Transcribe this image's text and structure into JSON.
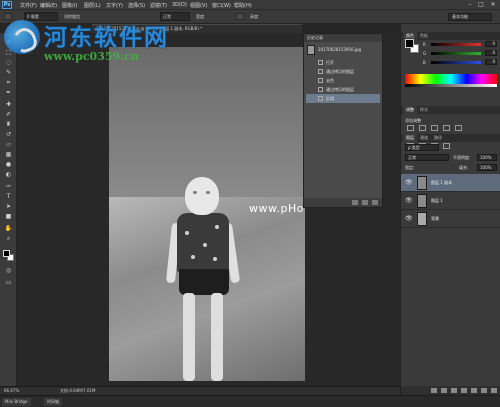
{
  "menubar": {
    "logo": "Ps",
    "items": [
      "文件(F)",
      "编辑(E)",
      "图像(I)",
      "图层(L)",
      "文字(Y)",
      "选择(S)",
      "滤镜(T)",
      "3D(D)",
      "视图(V)",
      "窗口(W)",
      "帮助(H)"
    ],
    "window_controls": [
      "–",
      "□",
      "✕"
    ]
  },
  "options": {
    "value_fields": [
      "0 像素",
      "消除锯齿",
      "正常",
      "宽度:",
      "高度:"
    ],
    "workspace": "基本功能"
  },
  "document_tab": "20170628153956.jpg @ 66.7% (图层 1 副本, RGB/8) *",
  "watermark": {
    "title": "河东软件网",
    "url": "www.pc0359.cn",
    "overlay": "www.pHome.NET"
  },
  "history": {
    "tab": "历史记录",
    "snapshot": "20170628153956.jpg",
    "states": [
      {
        "label": "打开",
        "active": false
      },
      {
        "label": "通过拷贝的图层",
        "active": false
      },
      {
        "label": "去色",
        "active": false
      },
      {
        "label": "通过拷贝的图层",
        "active": false
      },
      {
        "label": "反相",
        "active": true
      }
    ]
  },
  "color_panel": {
    "tabs": [
      "颜色",
      "色板"
    ],
    "sliders": [
      {
        "label": "R",
        "value": "0",
        "color": "#e03030"
      },
      {
        "label": "G",
        "value": "0",
        "color": "#30b030"
      },
      {
        "label": "B",
        "value": "0",
        "color": "#3050e0"
      }
    ]
  },
  "adjustments": {
    "tabs": [
      "调整",
      "样式"
    ],
    "title": "添加调整"
  },
  "layers": {
    "tabs": [
      "图层",
      "通道",
      "路径"
    ],
    "kind": "ρ 类型",
    "blend": "正常",
    "opacity_label": "不透明度:",
    "opacity": "100%",
    "lock_label": "锁定:",
    "fill_label": "填充:",
    "fill": "100%",
    "items": [
      {
        "name": "图层 1 副本",
        "active": true
      },
      {
        "name": "图层 1",
        "active": false
      },
      {
        "name": "背景",
        "active": false
      }
    ]
  },
  "status": {
    "zoom": "66.67%",
    "doc": "文档:4.64M/7.01M"
  },
  "bottom_tabs": [
    "Mini Bridge",
    "时间轴"
  ]
}
